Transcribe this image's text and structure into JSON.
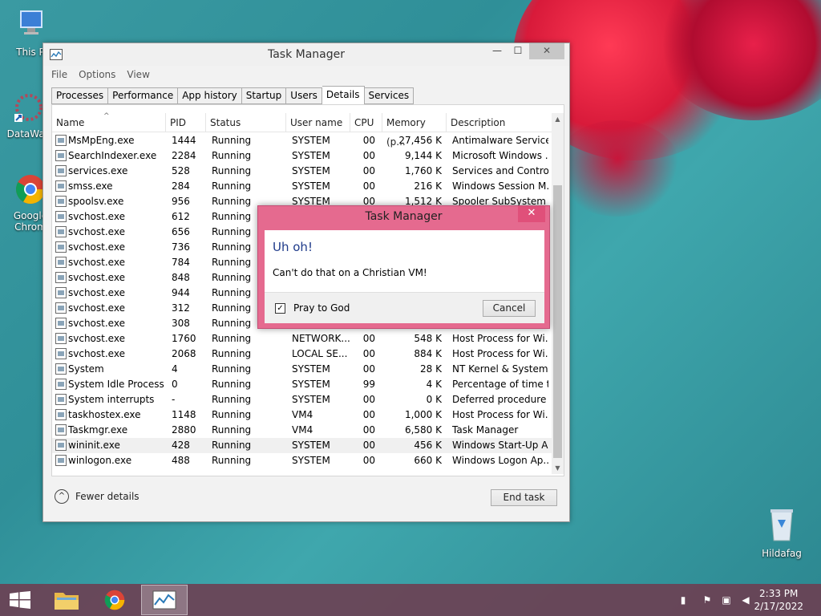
{
  "desktop": {
    "icons": [
      {
        "label": "This P"
      },
      {
        "label": "DataWag"
      },
      {
        "label": "Google Chrom"
      }
    ],
    "recycle_bin_label": "Hildafag"
  },
  "window": {
    "title": "Task Manager",
    "menu": [
      "File",
      "Options",
      "View"
    ],
    "tabs": [
      "Processes",
      "Performance",
      "App history",
      "Startup",
      "Users",
      "Details",
      "Services"
    ],
    "active_tab": "Details",
    "columns": [
      "Name",
      "PID",
      "Status",
      "User name",
      "CPU",
      "Memory (p...",
      "Description"
    ],
    "rows": [
      {
        "name": "MsMpEng.exe",
        "pid": "1444",
        "status": "Running",
        "user": "SYSTEM",
        "cpu": "00",
        "mem": "27,456 K",
        "desc": "Antimalware Service..."
      },
      {
        "name": "SearchIndexer.exe",
        "pid": "2284",
        "status": "Running",
        "user": "SYSTEM",
        "cpu": "00",
        "mem": "9,144 K",
        "desc": "Microsoft Windows ..."
      },
      {
        "name": "services.exe",
        "pid": "528",
        "status": "Running",
        "user": "SYSTEM",
        "cpu": "00",
        "mem": "1,760 K",
        "desc": "Services and Control..."
      },
      {
        "name": "smss.exe",
        "pid": "284",
        "status": "Running",
        "user": "SYSTEM",
        "cpu": "00",
        "mem": "216 K",
        "desc": "Windows Session M..."
      },
      {
        "name": "spoolsv.exe",
        "pid": "956",
        "status": "Running",
        "user": "SYSTEM",
        "cpu": "00",
        "mem": "1,512 K",
        "desc": "Spooler SubSystem ..."
      },
      {
        "name": "svchost.exe",
        "pid": "612",
        "status": "Running",
        "user": "",
        "cpu": "",
        "mem": "",
        "desc": ""
      },
      {
        "name": "svchost.exe",
        "pid": "656",
        "status": "Running",
        "user": "",
        "cpu": "",
        "mem": "",
        "desc": ""
      },
      {
        "name": "svchost.exe",
        "pid": "736",
        "status": "Running",
        "user": "",
        "cpu": "",
        "mem": "",
        "desc": ""
      },
      {
        "name": "svchost.exe",
        "pid": "784",
        "status": "Running",
        "user": "",
        "cpu": "",
        "mem": "",
        "desc": ""
      },
      {
        "name": "svchost.exe",
        "pid": "848",
        "status": "Running",
        "user": "",
        "cpu": "",
        "mem": "",
        "desc": ""
      },
      {
        "name": "svchost.exe",
        "pid": "944",
        "status": "Running",
        "user": "",
        "cpu": "",
        "mem": "",
        "desc": ""
      },
      {
        "name": "svchost.exe",
        "pid": "312",
        "status": "Running",
        "user": "",
        "cpu": "",
        "mem": "",
        "desc": ""
      },
      {
        "name": "svchost.exe",
        "pid": "308",
        "status": "Running",
        "user": "",
        "cpu": "",
        "mem": "",
        "desc": ""
      },
      {
        "name": "svchost.exe",
        "pid": "1760",
        "status": "Running",
        "user": "NETWORK...",
        "cpu": "00",
        "mem": "548 K",
        "desc": "Host Process for Wi..."
      },
      {
        "name": "svchost.exe",
        "pid": "2068",
        "status": "Running",
        "user": "LOCAL SE...",
        "cpu": "00",
        "mem": "884 K",
        "desc": "Host Process for Wi..."
      },
      {
        "name": "System",
        "pid": "4",
        "status": "Running",
        "user": "SYSTEM",
        "cpu": "00",
        "mem": "28 K",
        "desc": "NT Kernel & System"
      },
      {
        "name": "System Idle Process",
        "pid": "0",
        "status": "Running",
        "user": "SYSTEM",
        "cpu": "99",
        "mem": "4 K",
        "desc": "Percentage of time t..."
      },
      {
        "name": "System interrupts",
        "pid": "-",
        "status": "Running",
        "user": "SYSTEM",
        "cpu": "00",
        "mem": "0 K",
        "desc": "Deferred procedure ..."
      },
      {
        "name": "taskhostex.exe",
        "pid": "1148",
        "status": "Running",
        "user": "VM4",
        "cpu": "00",
        "mem": "1,000 K",
        "desc": "Host Process for Wi..."
      },
      {
        "name": "Taskmgr.exe",
        "pid": "2880",
        "status": "Running",
        "user": "VM4",
        "cpu": "00",
        "mem": "6,580 K",
        "desc": "Task Manager"
      },
      {
        "name": "wininit.exe",
        "pid": "428",
        "status": "Running",
        "user": "SYSTEM",
        "cpu": "00",
        "mem": "456 K",
        "desc": "Windows Start-Up A..."
      },
      {
        "name": "winlogon.exe",
        "pid": "488",
        "status": "Running",
        "user": "SYSTEM",
        "cpu": "00",
        "mem": "660 K",
        "desc": "Windows Logon Ap..."
      }
    ],
    "fewer_details_label": "Fewer details",
    "end_task_label": "End task"
  },
  "dialog": {
    "title": "Task Manager",
    "heading": "Uh oh!",
    "message": "Can't do that on a Christian VM!",
    "checkbox_label": "Pray to God",
    "checkbox_checked": true,
    "cancel_label": "Cancel"
  },
  "taskbar": {
    "time": "2:33 PM",
    "date": "2/17/2022"
  }
}
